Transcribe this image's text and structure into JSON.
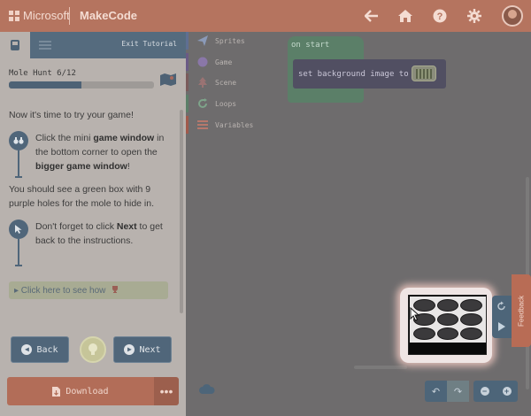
{
  "header": {
    "brand": "Microsoft",
    "product": "MakeCode",
    "icons": [
      "back-arrow-icon",
      "home-icon",
      "help-icon",
      "settings-icon"
    ]
  },
  "sidebar": {
    "exit_label": "Exit Tutorial",
    "mission": "Mole Hunt 6/12",
    "progress": 0.5,
    "intro": "Now it's time to try your game!",
    "hint1": {
      "a": "Click the mini ",
      "b": "game window",
      "c": " in the bottom corner to open the ",
      "d": "bigger game window",
      "e": "!"
    },
    "para2": "You should see a green box with 9 purple holes for the mole to hide in.",
    "hint2": {
      "a": "Don't forget to click ",
      "b": "Next",
      "c": " to get back to the instructions."
    },
    "how_link": "▸ Click here to see how",
    "back_label": "Back",
    "next_label": "Next",
    "download_label": "Download",
    "more_label": "•••"
  },
  "toolbox": {
    "categories": [
      {
        "label": "Sprites",
        "color": "#5f6f92",
        "icon": "paper-plane-icon"
      },
      {
        "label": "Game",
        "color": "#6a5a85",
        "icon": "game-circle-icon"
      },
      {
        "label": "Scene",
        "color": "#7a5b5b",
        "icon": "tree-icon"
      },
      {
        "label": "Loops",
        "color": "#5b7f68",
        "icon": "loop-icon"
      },
      {
        "label": "Variables",
        "color": "#a0594b",
        "icon": "list-icon"
      }
    ]
  },
  "workspace": {
    "on_start": "on start",
    "set_bg": "set background image to"
  },
  "feedback_label": "Feedback"
}
